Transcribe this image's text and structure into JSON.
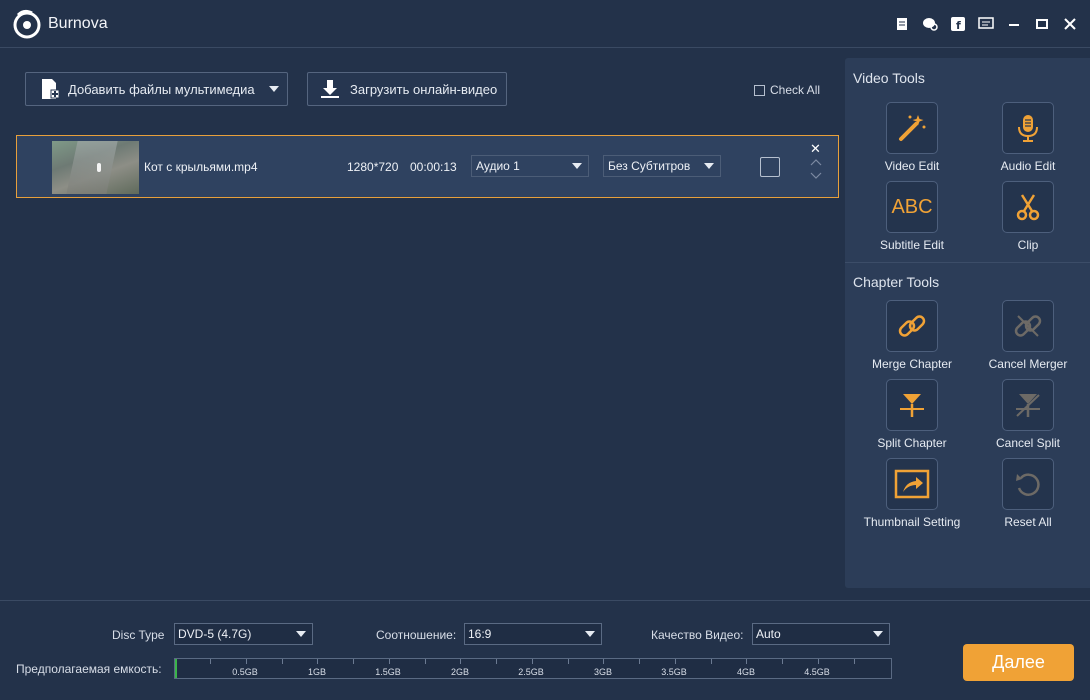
{
  "app": {
    "title": "Burnova"
  },
  "titlebar_icons": [
    "register-icon",
    "feedback-icon",
    "facebook-icon",
    "menu-icon",
    "minimize-icon",
    "maximize-icon",
    "close-icon"
  ],
  "toolbar": {
    "add_label": "Добавить файлы мультимедиа",
    "online_label": "Загрузить онлайн-видео",
    "check_all_label": "Check All"
  },
  "files": [
    {
      "name": "Кот с крыльями.mp4",
      "resolution": "1280*720",
      "duration": "00:00:13",
      "audio": "Аудио 1",
      "subtitle": "Без Субтитров"
    }
  ],
  "video_tools": {
    "title": "Video Tools",
    "items": [
      "Video Edit",
      "Audio Edit",
      "Subtitle Edit",
      "Clip"
    ],
    "abc_text": "ABC"
  },
  "chapter_tools": {
    "title": "Chapter Tools",
    "items": [
      "Merge Chapter",
      "Cancel Merger",
      "Split Chapter",
      "Cancel Split",
      "Thumbnail Setting",
      "Reset All"
    ]
  },
  "bottom": {
    "disc_type_label": "Disc Type",
    "disc_type_value": "DVD-5 (4.7G)",
    "ratio_label": "Соотношение:",
    "ratio_value": "16:9",
    "quality_label": "Качество Видео:",
    "quality_value": "Auto",
    "capacity_label": "Предполагаемая емкость:",
    "capacity_fraction": 0.002,
    "capacity_ticks": [
      "0.5GB",
      "1GB",
      "1.5GB",
      "2GB",
      "2.5GB",
      "3GB",
      "3.5GB",
      "4GB",
      "4.5GB"
    ],
    "next_label": "Далее"
  },
  "colors": {
    "accent": "#f0a236",
    "background": "#23324a",
    "selection": "#e8a03b"
  }
}
